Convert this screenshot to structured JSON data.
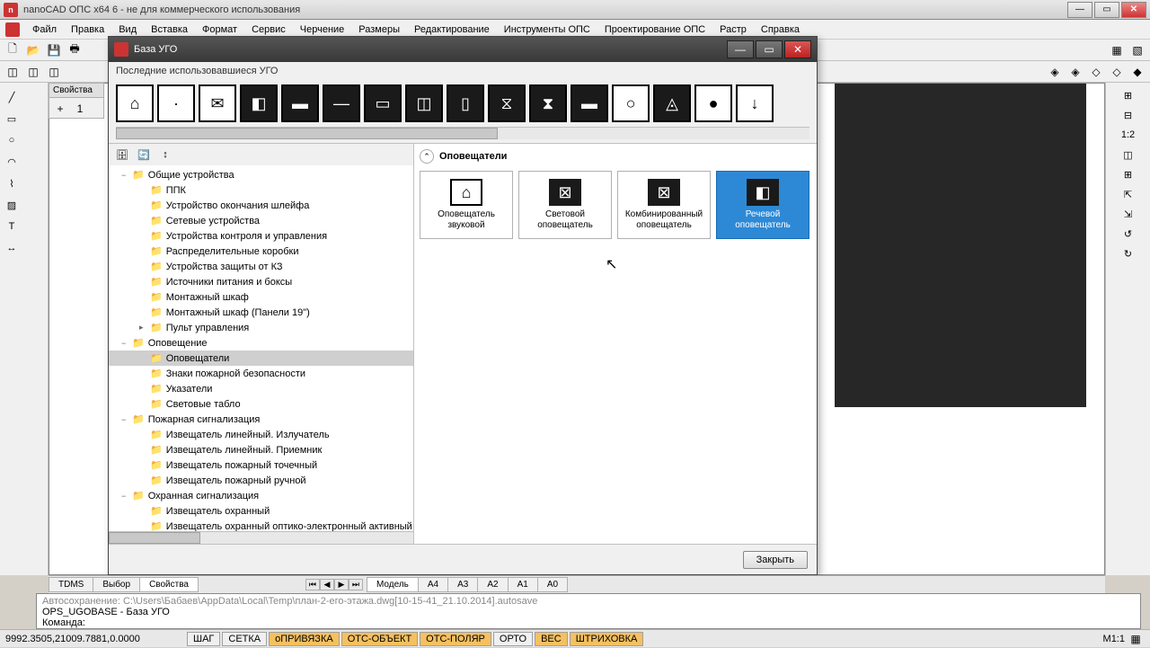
{
  "main_window": {
    "title": "nanoCAD ОПС x64 6 - не для коммерческого использования"
  },
  "menu": {
    "items": [
      "Файл",
      "Правка",
      "Вид",
      "Вставка",
      "Формат",
      "Сервис",
      "Черчение",
      "Размеры",
      "Редактирование",
      "Инструменты ОПС",
      "Проектирование ОПС",
      "Растр",
      "Справка"
    ]
  },
  "props_panel": {
    "title": "Свойства"
  },
  "dialog": {
    "title": "База УГО",
    "recent_label": "Последние использовавшиеся УГО",
    "content_title": "Оповещатели",
    "close_btn": "Закрыть",
    "items": [
      {
        "label": "Оповещатель звуковой",
        "selected": false,
        "light": true
      },
      {
        "label": "Световой оповещатель",
        "selected": false,
        "light": false
      },
      {
        "label": "Комбинированный оповещатель",
        "selected": false,
        "light": false
      },
      {
        "label": "Речевой оповещатель",
        "selected": true,
        "light": false
      }
    ],
    "tree": [
      {
        "d": 1,
        "label": "Общие устройства",
        "exp": "−"
      },
      {
        "d": 2,
        "label": "ППК"
      },
      {
        "d": 2,
        "label": "Устройство окончания шлейфа"
      },
      {
        "d": 2,
        "label": "Сетевые устройства"
      },
      {
        "d": 2,
        "label": "Устройства контроля и управления"
      },
      {
        "d": 2,
        "label": "Распределительные коробки"
      },
      {
        "d": 2,
        "label": "Устройства защиты от КЗ"
      },
      {
        "d": 2,
        "label": "Источники питания и боксы"
      },
      {
        "d": 2,
        "label": "Монтажный шкаф"
      },
      {
        "d": 2,
        "label": "Монтажный шкаф (Панели 19\")"
      },
      {
        "d": 2,
        "label": "Пульт управления",
        "exp": "▸"
      },
      {
        "d": 1,
        "label": "Оповещение",
        "exp": "−"
      },
      {
        "d": 2,
        "label": "Оповещатели",
        "selected": true
      },
      {
        "d": 2,
        "label": "Знаки пожарной безопасности"
      },
      {
        "d": 2,
        "label": "Указатели"
      },
      {
        "d": 2,
        "label": "Световые табло"
      },
      {
        "d": 1,
        "label": "Пожарная сигнализация",
        "exp": "−"
      },
      {
        "d": 2,
        "label": "Извещатель линейный. Излучатель"
      },
      {
        "d": 2,
        "label": "Извещатель линейный. Приемник"
      },
      {
        "d": 2,
        "label": "Извещатель пожарный точечный"
      },
      {
        "d": 2,
        "label": "Извещатель пожарный ручной"
      },
      {
        "d": 1,
        "label": "Охранная сигнализация",
        "exp": "−"
      },
      {
        "d": 2,
        "label": "Извещатель охранный"
      },
      {
        "d": 2,
        "label": "Извещатель охранный оптико-электронный активный"
      }
    ]
  },
  "bottom_tabs": {
    "left": [
      "TDMS",
      "Выбор",
      "Свойства"
    ],
    "active_left": "Свойства",
    "sheets": [
      "Модель",
      "A4",
      "A3",
      "A2",
      "A1",
      "A0"
    ]
  },
  "cmd": {
    "line1": "Автосохранение: C:\\Users\\Бабаев\\AppData\\Local\\Temp\\план-2-его-этажа.dwg[10-15-41_21.10.2014].autosave",
    "line2": "OPS_UGOBASE - База УГО",
    "line3": "Команда:"
  },
  "status": {
    "coords": "9992.3505,21009.7881,0.0000",
    "buttons": [
      "ШАГ",
      "СЕТКА",
      "оПРИВЯЗКА",
      "ОТС-ОБЪЕКТ",
      "ОТС-ПОЛЯР",
      "ОРТО",
      "ВЕС",
      "ШТРИХОВКА"
    ],
    "active": [
      "оПРИВЯЗКА",
      "ОТС-ОБЪЕКТ",
      "ОТС-ПОЛЯР",
      "ВЕС",
      "ШТРИХОВКА"
    ],
    "scale": "М1:1"
  }
}
